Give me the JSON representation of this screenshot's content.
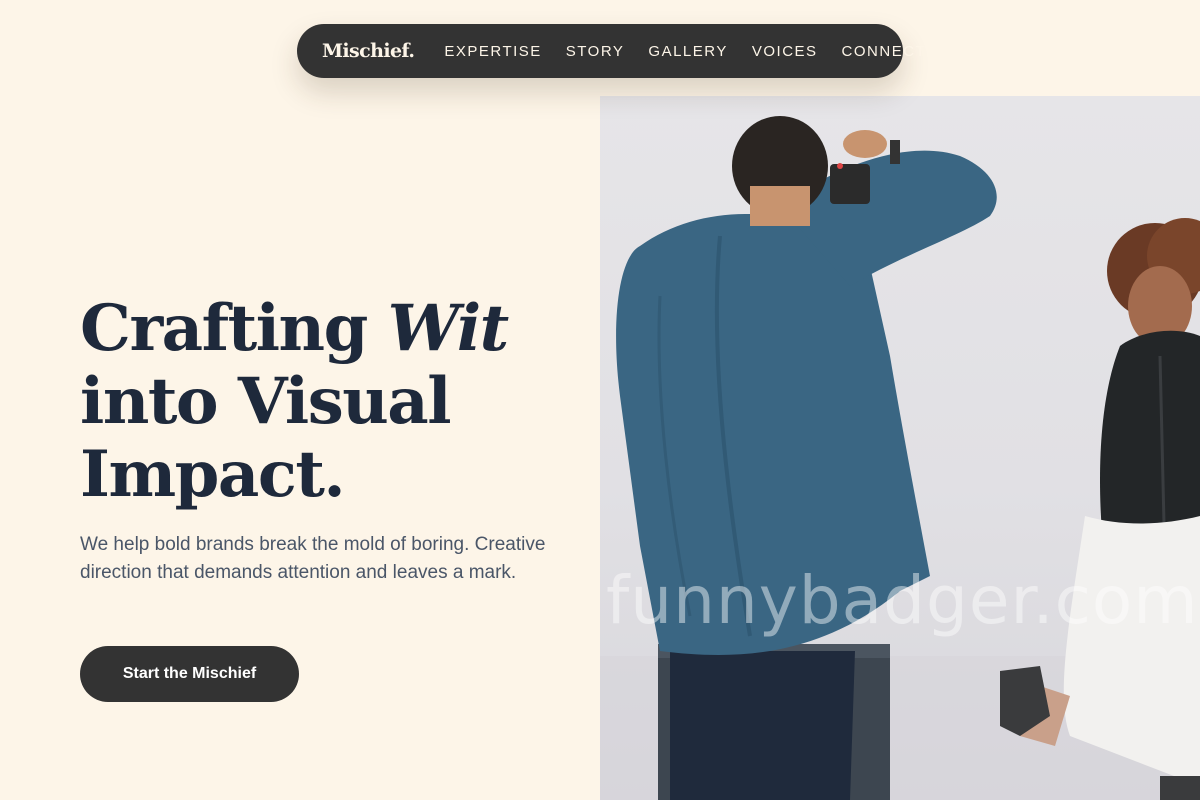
{
  "nav": {
    "brand": "Mischief.",
    "links": [
      "EXPERTISE",
      "STORY",
      "GALLERY",
      "VOICES",
      "CONNECT"
    ]
  },
  "hero": {
    "title_line1": "Crafting ",
    "title_em": "Wit",
    "title_line2": "into Visual",
    "title_line3": "Impact.",
    "subtitle": "We help bold brands break the mold of boring. Creative direction that demands attention and leaves a mark.",
    "cta_label": "Start the Mischief"
  },
  "photo": {
    "watermark": "funnybadger.com"
  },
  "colors": {
    "background": "#fdf5e8",
    "nav_bg": "#333333",
    "heading": "#1e293b",
    "body_text": "#4a5668"
  }
}
